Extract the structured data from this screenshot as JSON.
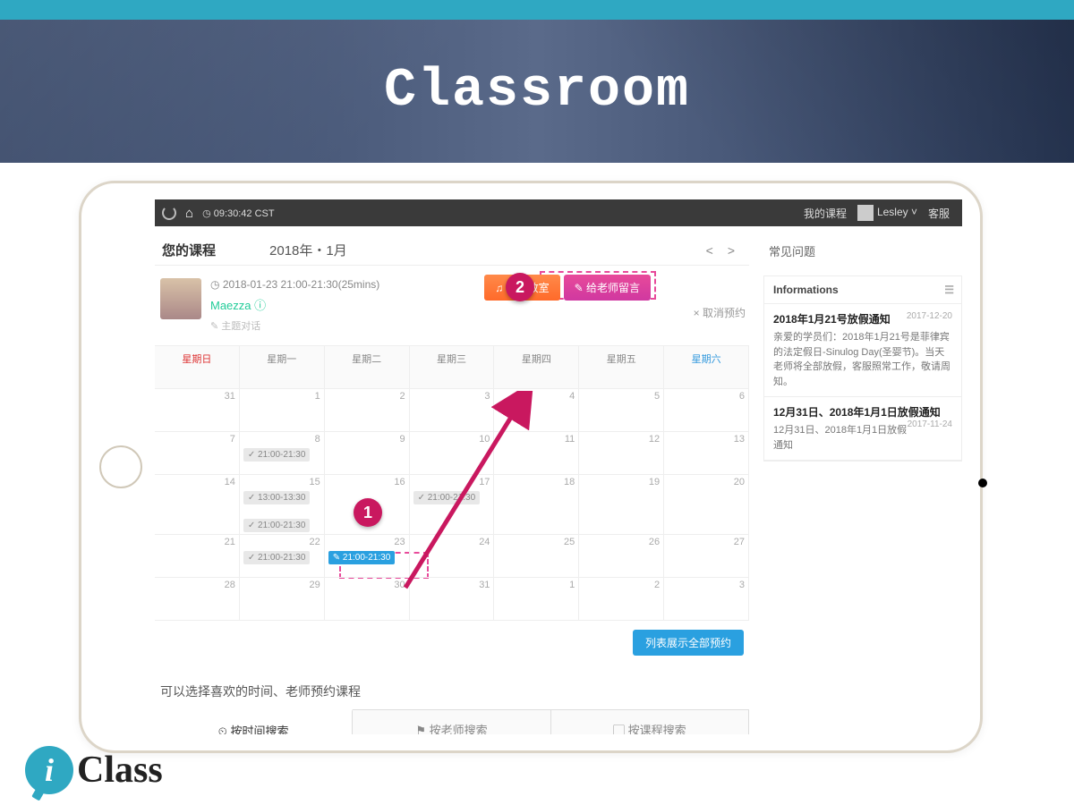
{
  "banner": {
    "title": "Classroom"
  },
  "statusbar": {
    "time": "09:30:42 CST",
    "nav_courses": "我的课程",
    "username": "Lesley",
    "support": "客服"
  },
  "course": {
    "header": "您的课程",
    "month": "2018年・1月"
  },
  "session": {
    "datetime": "2018-01-23  21:00-21:30(25mins)",
    "teacher": "Maezza",
    "topic": "主题对话",
    "enter_btn": "进入教室",
    "msg_btn": "给老师留言",
    "cancel": "× 取消预约"
  },
  "callouts": {
    "one": "1",
    "two": "2"
  },
  "weekdays": [
    "星期日",
    "星期一",
    "星期二",
    "星期三",
    "星期四",
    "星期五",
    "星期六"
  ],
  "calendar": {
    "rows": [
      [
        {
          "n": "31"
        },
        {
          "n": "1"
        },
        {
          "n": "2"
        },
        {
          "n": "3"
        },
        {
          "n": "4"
        },
        {
          "n": "5"
        },
        {
          "n": "6"
        }
      ],
      [
        {
          "n": "7"
        },
        {
          "n": "8",
          "slots": [
            "21:00-21:30"
          ]
        },
        {
          "n": "9"
        },
        {
          "n": "10"
        },
        {
          "n": "11"
        },
        {
          "n": "12"
        },
        {
          "n": "13"
        }
      ],
      [
        {
          "n": "14"
        },
        {
          "n": "15",
          "slots": [
            "13:00-13:30",
            "21:00-21:30"
          ]
        },
        {
          "n": "16"
        },
        {
          "n": "17",
          "slots": [
            "21:00-21:30"
          ]
        },
        {
          "n": "18"
        },
        {
          "n": "19"
        },
        {
          "n": "20"
        }
      ],
      [
        {
          "n": "21"
        },
        {
          "n": "22",
          "slots": [
            "21:00-21:30"
          ]
        },
        {
          "n": "23",
          "active": "21:00-21:30"
        },
        {
          "n": "24"
        },
        {
          "n": "25"
        },
        {
          "n": "26"
        },
        {
          "n": "27"
        }
      ],
      [
        {
          "n": "28"
        },
        {
          "n": "29"
        },
        {
          "n": "30"
        },
        {
          "n": "31"
        },
        {
          "n": "1"
        },
        {
          "n": "2"
        },
        {
          "n": "3"
        }
      ]
    ],
    "show_all": "列表展示全部预约"
  },
  "hint": "可以选择喜欢的时间、老师预约课程",
  "tabs": [
    "按时间搜索",
    "按老师搜索",
    "按课程搜索"
  ],
  "sidebar": {
    "faq": "常见问题",
    "info_header": "Informations",
    "items": [
      {
        "title": "2018年1月21号放假通知",
        "date": "2017-12-20",
        "body": "亲爱的学员们：2018年1月21号是菲律宾的法定假日-Sinulog Day(圣婴节)。当天老师将全部放假，客服照常工作，敬请周知。"
      },
      {
        "title": "12月31日、2018年1月1日放假通知",
        "date": "2017-11-24",
        "body": "12月31日、2018年1月1日放假通知"
      }
    ]
  },
  "logo": {
    "i": "i",
    "text": "Class"
  }
}
